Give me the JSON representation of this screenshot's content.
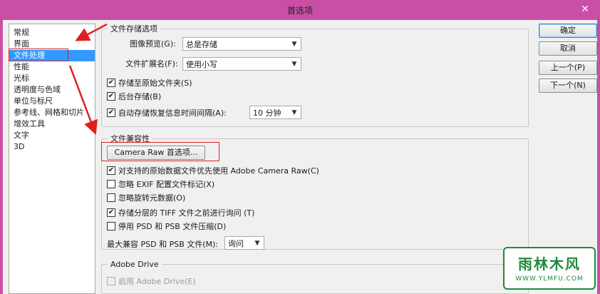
{
  "window": {
    "title": "首选项",
    "close_glyph": "✕"
  },
  "sidebar": {
    "items": [
      {
        "label": "常规",
        "selected": false
      },
      {
        "label": "界面",
        "selected": false
      },
      {
        "label": "文件处理",
        "selected": true
      },
      {
        "label": "性能",
        "selected": false
      },
      {
        "label": "光标",
        "selected": false
      },
      {
        "label": "透明度与色域",
        "selected": false
      },
      {
        "label": "单位与标尺",
        "selected": false
      },
      {
        "label": "参考线、网格和切片",
        "selected": false
      },
      {
        "label": "增效工具",
        "selected": false
      },
      {
        "label": "文字",
        "selected": false
      },
      {
        "label": "3D",
        "selected": false
      }
    ]
  },
  "file_saving": {
    "legend": "文件存储选项",
    "image_preview": {
      "label": "图像预览(G):",
      "value": "总是存储"
    },
    "file_extension": {
      "label": "文件扩展名(F):",
      "value": "使用小写"
    },
    "save_as_original_folder": {
      "label": "存储至原始文件夹(S)",
      "checked": true
    },
    "background_save": {
      "label": "后台存储(B)",
      "checked": true
    },
    "auto_save": {
      "label": "自动存储恢复信息时间间隔(A):",
      "checked": true,
      "value": "10 分钟"
    }
  },
  "compatibility": {
    "legend": "文件兼容性",
    "camera_raw_button": "Camera Raw 首选项...",
    "prefer_acr": {
      "label": "对支持的原始数据文件优先使用 Adobe Camera Raw(C)",
      "checked": true
    },
    "ignore_exif": {
      "label": "忽略 EXIF 配置文件标记(X)",
      "checked": false
    },
    "ignore_rotation": {
      "label": "忽略旋转元数据(O)",
      "checked": false
    },
    "ask_tiff_layers": {
      "label": "存储分层的 TIFF 文件之前进行询问 (T)",
      "checked": true
    },
    "disable_psd_compression": {
      "label": "停用 PSD 和 PSB 文件压缩(D)",
      "checked": false
    },
    "maximize_compat": {
      "label": "最大兼容 PSD 和 PSB 文件(M):",
      "value": "询问"
    }
  },
  "adobe_drive": {
    "legend": "Adobe Drive",
    "enable": {
      "label": "启用 Adobe Drive(E)",
      "checked": false
    }
  },
  "buttons": {
    "ok": "确定",
    "cancel": "取消",
    "prev": "上一个(P)",
    "next": "下一个(N)"
  },
  "watermark": {
    "main": "雨林木风",
    "sub": "WWW.YLMFU.COM"
  },
  "colors": {
    "titlebar": "#c94fa6",
    "selection": "#3399ff",
    "annotation": "#e02020"
  }
}
